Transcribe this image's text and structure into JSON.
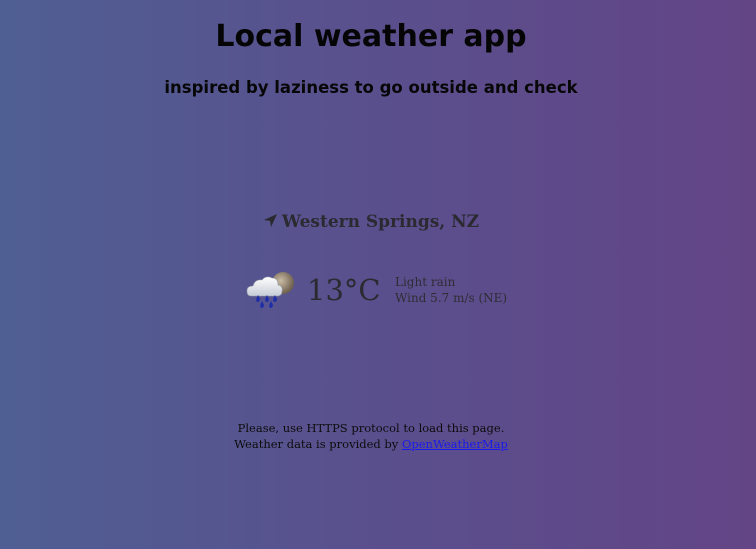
{
  "header": {
    "title": "Local weather app",
    "subtitle": "inspired by laziness to go outside and check"
  },
  "location": {
    "icon": "location-arrow-icon",
    "name": "Western Springs, NZ"
  },
  "weather": {
    "icon": "light-rain-icon",
    "temperature": "13°C",
    "condition": "Light rain",
    "wind": "Wind 5.7 m/s (NE)"
  },
  "footer": {
    "https_notice": "Please, use HTTPS protocol to load this page.",
    "provider_text": "Weather data is provided by ",
    "provider_link": "OpenWeatherMap"
  },
  "colors": {
    "background_left": "#4f5f93",
    "background_right": "#634586",
    "link": "#1a1aee"
  }
}
